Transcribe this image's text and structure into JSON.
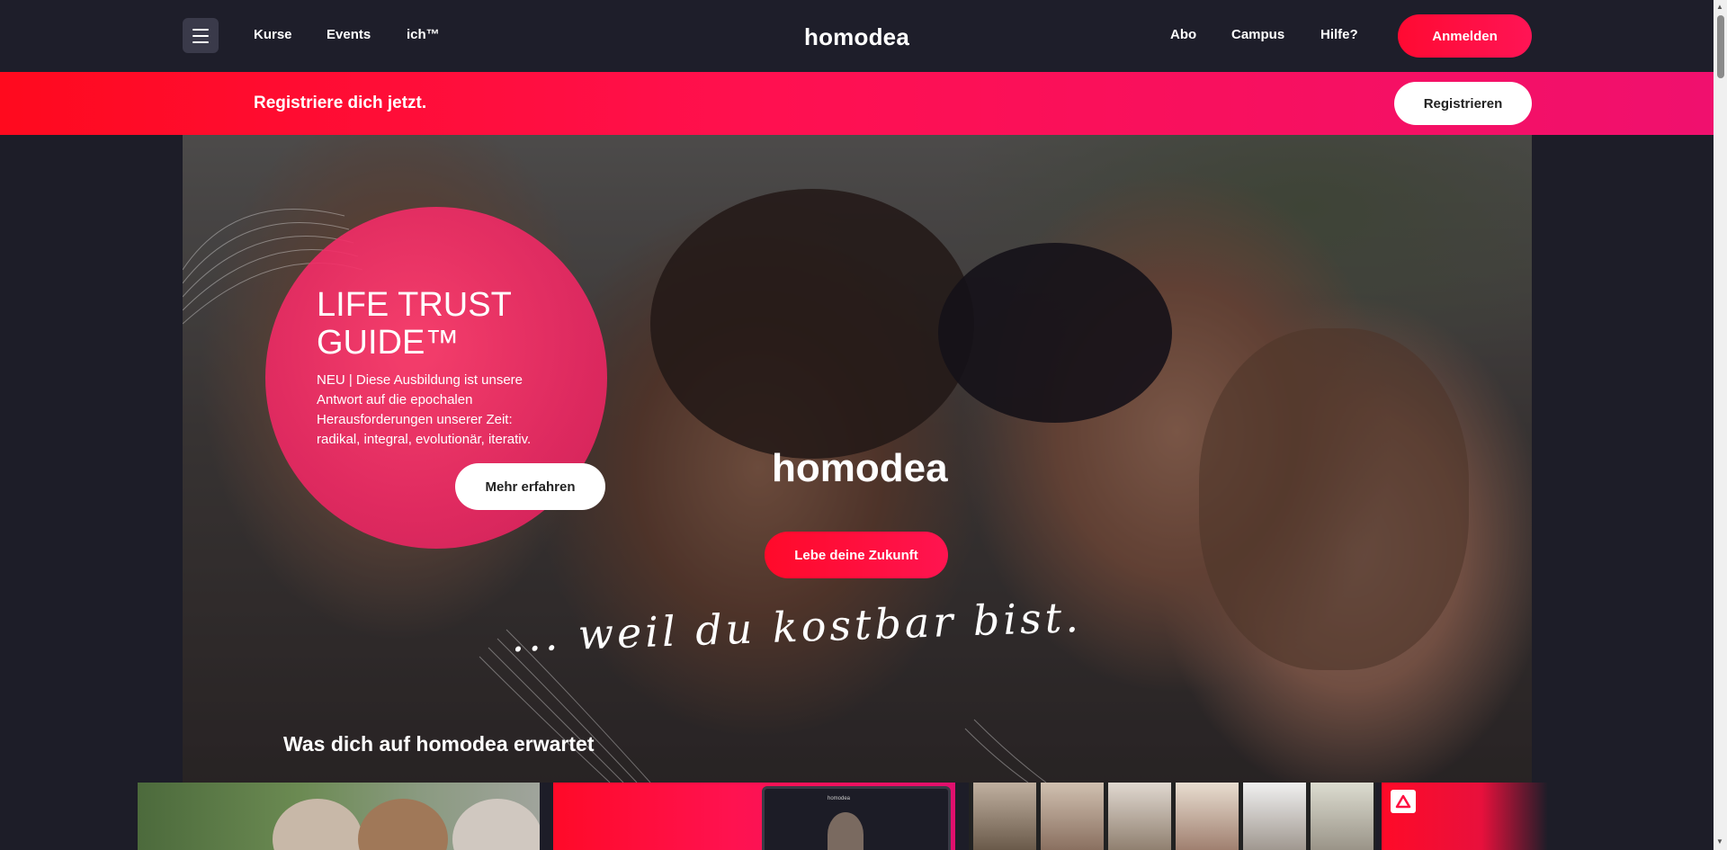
{
  "header": {
    "nav_left": [
      "Kurse",
      "Events",
      "ich™"
    ],
    "brand": "homodea",
    "nav_right": [
      "Abo",
      "Campus",
      "Hilfe?"
    ],
    "login_label": "Anmelden"
  },
  "banner": {
    "text": "Registriere dich jetzt.",
    "register_label": "Registrieren"
  },
  "hero": {
    "promo_title": "LIFE TRUST GUIDE™",
    "promo_text": "NEU | Diese Ausbildung ist unsere Antwort auf die epochalen Herausforderungen unserer Zeit: radikal, integral, evolutionär, iterativ.",
    "promo_button": "Mehr erfahren",
    "brand": "homodea",
    "cta_label": "Lebe deine Zukunft",
    "tagline": "... weil du kostbar bist."
  },
  "section": {
    "title": "Was dich auf homodea erwartet"
  },
  "cards": {
    "laptop_brand": "homodea"
  },
  "colors": {
    "accent": "#ff0a32",
    "accent_pink": "#f0106e",
    "background": "#1d1d28"
  }
}
